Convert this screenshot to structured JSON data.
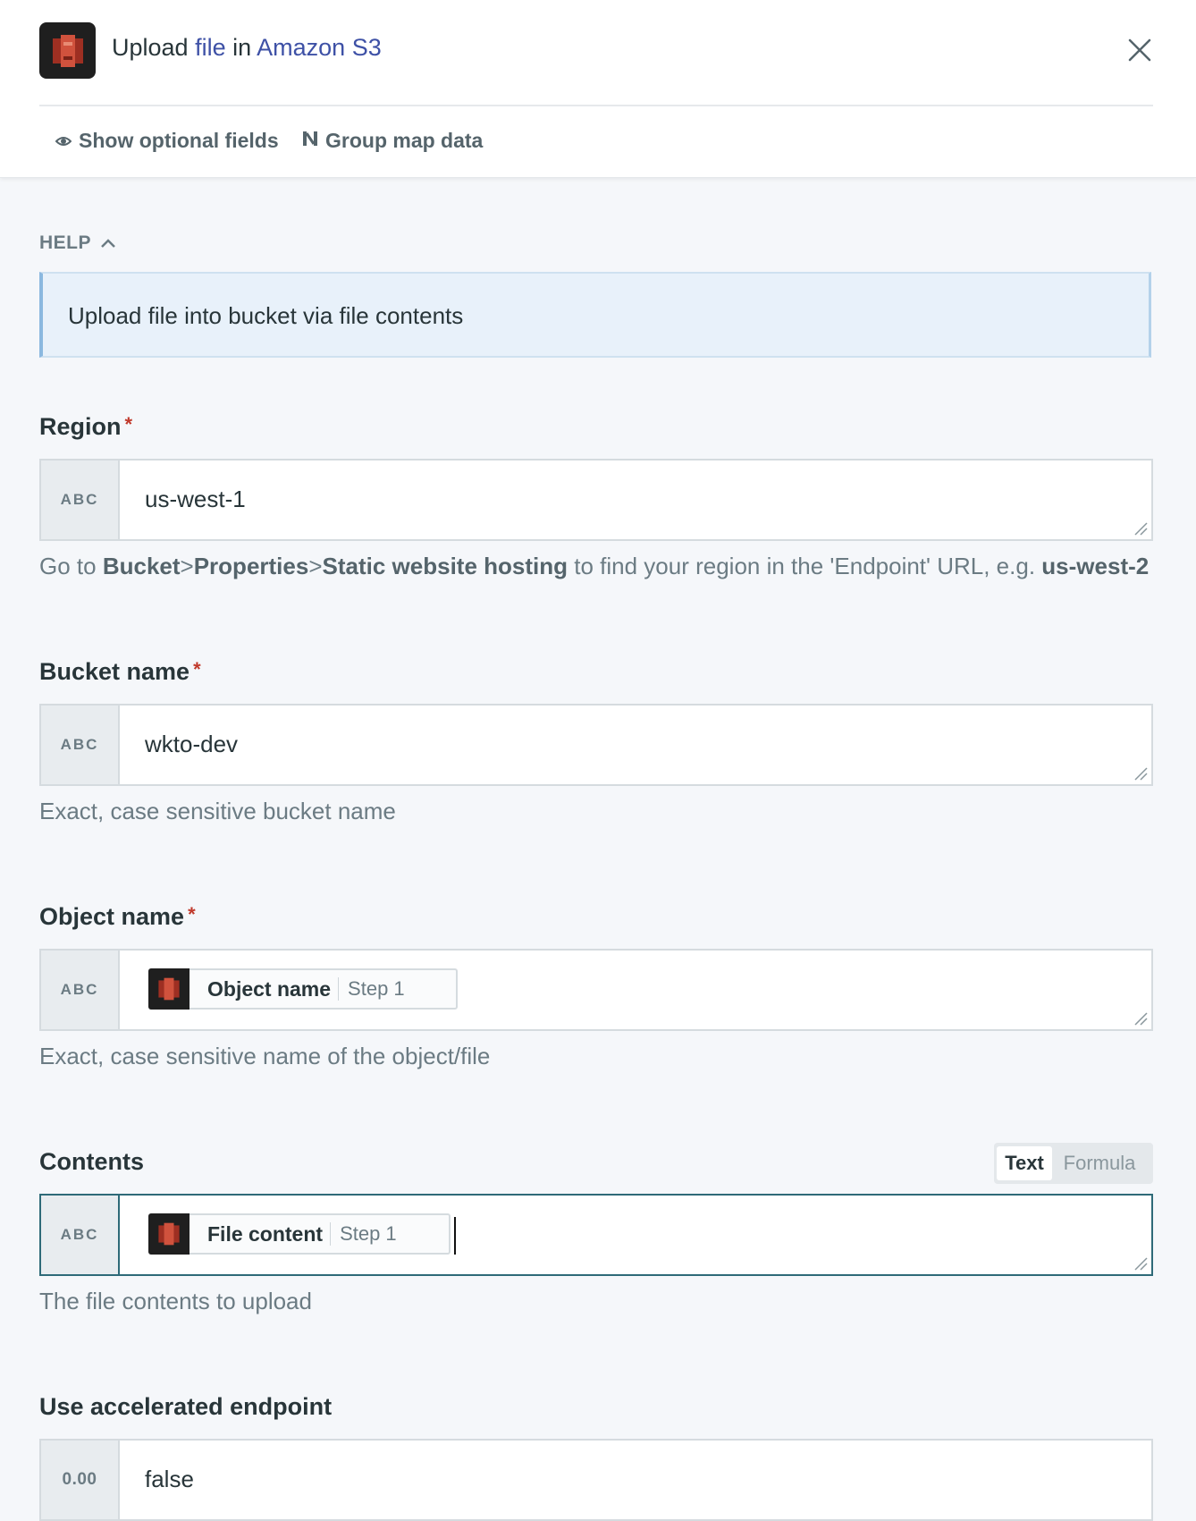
{
  "header": {
    "title_prefix": "Upload",
    "title_action": "file",
    "title_in": "in",
    "title_app": "Amazon S3",
    "logo_icon": "amazon-s3-icon",
    "close_icon": "close-icon"
  },
  "toolbar": {
    "show_optional_label": "Show optional fields",
    "group_map_label": "Group map data"
  },
  "help": {
    "label": "HELP",
    "text": "Upload file into bucket via file contents"
  },
  "fields": {
    "region": {
      "label": "Region",
      "required_mark": "*",
      "type": "ABC",
      "value": "us-west-1",
      "hint_prefix": "Go to",
      "hint_b1": "Bucket",
      "hint_gt1": ">",
      "hint_b2": "Properties",
      "hint_gt2": ">",
      "hint_b3": "Static website hosting",
      "hint_mid": "to find your region in the 'Endpoint' URL, e.g.",
      "hint_b4": "us-west-2"
    },
    "bucket": {
      "label": "Bucket name",
      "required_mark": "*",
      "type": "ABC",
      "value": "wkto-dev",
      "hint": "Exact, case sensitive bucket name"
    },
    "object": {
      "label": "Object name",
      "required_mark": "*",
      "type": "ABC",
      "pill_name": "Object name",
      "pill_step": "Step 1",
      "hint": "Exact, case sensitive name of the object/file"
    },
    "contents": {
      "label": "Contents",
      "type": "ABC",
      "pill_name": "File content",
      "pill_step": "Step 1",
      "hint": "The file contents to upload",
      "mode_text": "Text",
      "mode_formula": "Formula"
    },
    "accelerated": {
      "label": "Use accelerated endpoint",
      "type": "0.00",
      "value": "false"
    }
  },
  "colors": {
    "link": "#3e51a6",
    "required": "#c0392b",
    "focus_border": "#2e6a78",
    "help_bg": "#e8f1fa",
    "s3_red": "#c7412e"
  }
}
